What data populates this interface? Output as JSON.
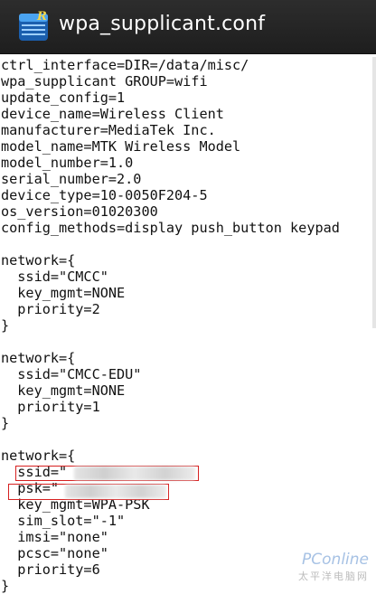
{
  "app_bar": {
    "icon": "root-explorer-app-icon",
    "title": "wpa_supplicant.conf"
  },
  "file_lines": [
    "ctrl_interface=DIR=/data/misc/",
    "wpa_supplicant GROUP=wifi",
    "update_config=1",
    "device_name=Wireless Client",
    "manufacturer=MediaTek Inc.",
    "model_name=MTK Wireless Model",
    "model_number=1.0",
    "serial_number=2.0",
    "device_type=10-0050F204-5",
    "os_version=01020300",
    "config_methods=display push_button keypad",
    "",
    "network={",
    "  ssid=\"CMCC\"",
    "  key_mgmt=NONE",
    "  priority=2",
    "}",
    "",
    "network={",
    "  ssid=\"CMCC-EDU\"",
    "  key_mgmt=NONE",
    "  priority=1",
    "}",
    "",
    "network={",
    "  ssid=\"",
    "  psk=\"",
    "  key_mgmt=WPA-PSK",
    "  sim_slot=\"-1\"",
    "  imsi=\"none\"",
    "  pcsc=\"none\"",
    "  priority=6",
    "}"
  ],
  "watermark": {
    "logo": "PConline",
    "sub": "太平洋电脑网"
  },
  "colors": {
    "app_bar_bg": "#262626",
    "highlight_border": "#d62020"
  }
}
